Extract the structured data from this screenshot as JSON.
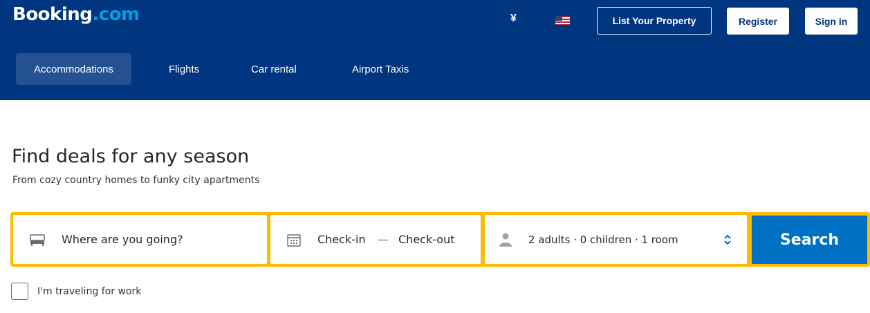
{
  "colors": {
    "header_bg": "#003580",
    "logo_dot": "#009fe3",
    "search_border": "#febb02",
    "search_button": "#0071c2"
  },
  "header": {
    "logo_main": "Booking",
    "logo_suffix": ".com",
    "currency": "¥",
    "language_icon": "us-flag-icon",
    "list_property": "List Your Property",
    "register": "Register",
    "sign_in": "Sign in"
  },
  "nav": {
    "items": [
      {
        "label": "Accommodations",
        "active": true
      },
      {
        "label": "Flights",
        "active": false
      },
      {
        "label": "Car rental",
        "active": false
      },
      {
        "label": "Airport Taxis",
        "active": false
      }
    ]
  },
  "hero": {
    "headline": "Find deals for any season",
    "subline": "From cozy country homes to funky city apartments"
  },
  "search": {
    "destination_placeholder": "Where are you going?",
    "checkin": "Check-in",
    "dash": "—",
    "checkout": "Check-out",
    "guests": "2 adults · 0 children · 1 room",
    "button": "Search",
    "icons": {
      "destination": "bed-icon",
      "dates": "calendar-icon",
      "guests": "person-icon",
      "guests_toggle": "updown-chevron-icon"
    }
  },
  "work_checkbox": {
    "label": "I'm traveling for work",
    "checked": false
  }
}
